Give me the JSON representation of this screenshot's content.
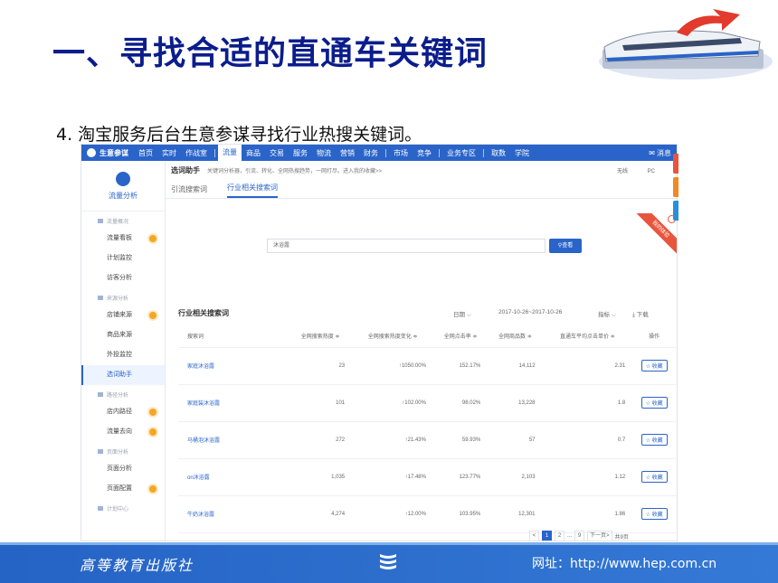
{
  "slide": {
    "title": "一、寻找合适的直通车关键词",
    "subtitle": "4. 淘宝服务后台生意参谋寻找行业热搜关键词。"
  },
  "topnav": {
    "brand": "生意参谋",
    "items": [
      "首页",
      "实时",
      "作战室",
      "流量",
      "商品",
      "交易",
      "服务",
      "物流",
      "营销",
      "财务",
      "市场",
      "竞争",
      "业务专区",
      "取数",
      "学院"
    ],
    "active": "流量",
    "message": "消息"
  },
  "sidebar": {
    "header": "流量分析",
    "groups": [
      {
        "title": "流量概况",
        "items": [
          "流量看板",
          "计划监控",
          "访客分析"
        ]
      },
      {
        "title": "来源分析",
        "items": [
          "店铺来源",
          "商品来源",
          "外投监控",
          "选词助手"
        ]
      },
      {
        "title": "路径分析",
        "items": [
          "店内路径",
          "流量去向"
        ]
      },
      {
        "title": "页面分析",
        "items": [
          "页面分析",
          "页面配置"
        ]
      },
      {
        "title": "计划中心",
        "items": []
      }
    ],
    "active_item": "选词助手"
  },
  "main": {
    "crumb_title": "选词助手",
    "crumb_desc": "关键词分析器，引流、转化、全网热搜趋势，一网打尽。进入我的收藏>>",
    "right_a": "无线",
    "right_b": "PC",
    "tabs": [
      "引流搜索词",
      "行业相关搜索词"
    ],
    "active_tab": "行业相关搜索词",
    "ribbon": "我的体验"
  },
  "search": {
    "value": "沐浴露",
    "button": "查看"
  },
  "section": {
    "title": "行业相关搜索词",
    "date_label": "日期",
    "date_range": "2017-10-26~2017-10-26",
    "metric_label": "指标",
    "download": "下载"
  },
  "table": {
    "headers": [
      "搜索词",
      "全网搜索热度 ≑",
      "全网搜索热度变化 ≑",
      "全网点击率 ≑",
      "全网商品数 ≑",
      "直通车平均点击单价 ≑",
      "操作"
    ],
    "rows": [
      {
        "kw": "家庭沐浴露",
        "heat": "23",
        "change": "1050.00%",
        "ctr": "152.17%",
        "goods": "14,112",
        "cpc": "2.31",
        "op": "收藏"
      },
      {
        "kw": "家庭装沐浴露",
        "heat": "101",
        "change": "102.00%",
        "ctr": "98.02%",
        "goods": "13,228",
        "cpc": "1.8",
        "op": "收藏"
      },
      {
        "kw": "马桶泡沐浴露",
        "heat": "272",
        "change": "21.43%",
        "ctr": "59.93%",
        "goods": "57",
        "cpc": "0.7",
        "op": "收藏"
      },
      {
        "kw": "on沐浴露",
        "heat": "1,035",
        "change": "17.48%",
        "ctr": "123.77%",
        "goods": "2,103",
        "cpc": "1.12",
        "op": "收藏"
      },
      {
        "kw": "牛奶沐浴露",
        "heat": "4,274",
        "change": "12.00%",
        "ctr": "103.95%",
        "goods": "12,301",
        "cpc": "1.86",
        "op": "收藏"
      }
    ]
  },
  "pager": {
    "prev": "<",
    "pages": [
      "1",
      "2",
      "...",
      "9"
    ],
    "active": "1",
    "next": "下一页>",
    "total": "共9页"
  },
  "footer": {
    "publisher": "高等教育出版社",
    "site": "网址：http://www.hep.com.cn"
  },
  "colors": {
    "title": "#0b1d8c",
    "accent": "#2a64c9",
    "footer": "#2563c4",
    "up": "#e34a3c"
  }
}
